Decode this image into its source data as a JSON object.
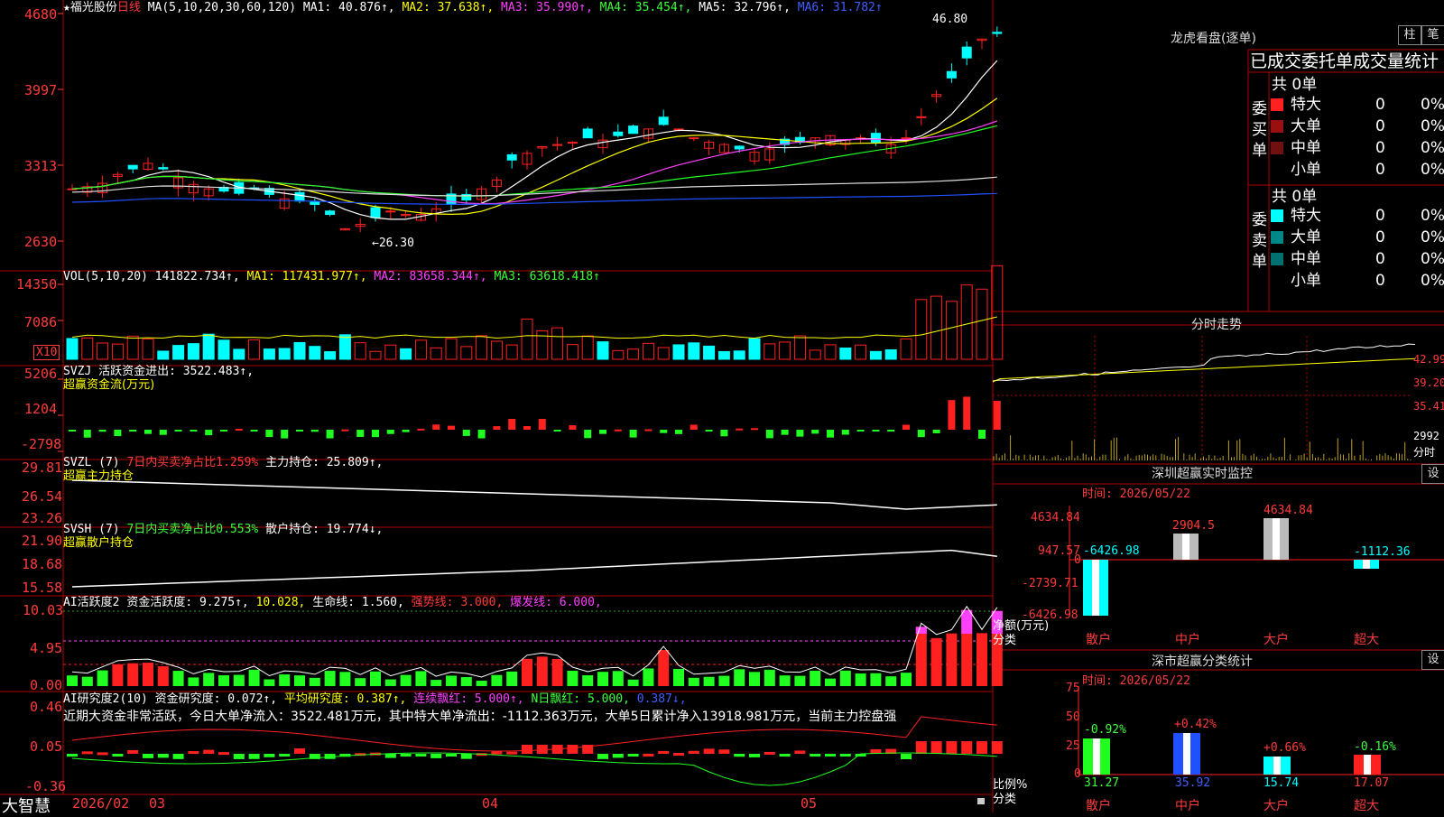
{
  "colors": {
    "up": "#ff2020",
    "down": "#00ffff",
    "bg": "#000000",
    "border": "#b00000",
    "white": "#ffffff",
    "yellow": "#ffff00",
    "magenta": "#ff40ff",
    "green": "#20ff20",
    "blue": "#2050ff"
  },
  "main": {
    "header_star": "★",
    "stock_name": "福光股份",
    "period": "日线",
    "ma_params": "MA(5,10,20,30,60,120)",
    "ma1": "MA1: 40.876↑,",
    "ma2": "MA2: 37.638↑,",
    "ma3": "MA3: 35.990↑,",
    "ma4": "MA4: 35.454↑,",
    "ma5": "MA5: 32.796↑,",
    "ma6": "MA6: 31.782↑",
    "price_ticks": [
      "4680",
      "3997",
      "3313",
      "2630"
    ],
    "high_label": "46.80",
    "low_label": "←26.30"
  },
  "vol": {
    "title": "VOL(5,10,20)",
    "val": "141822.734↑,",
    "ma1": "MA1: 117431.977↑,",
    "ma2": "MA2: 83658.344↑,",
    "ma3": "MA3: 63618.418↑",
    "ticks": [
      "14350",
      "7086"
    ],
    "unit": "X10"
  },
  "svzj": {
    "title": "SVZJ",
    "label": "活跃资金进出: 3522.483↑,",
    "subtitle": "超赢资金流(万元)",
    "ticks": [
      "5206",
      "1204",
      "-2798"
    ]
  },
  "svzl": {
    "title": "SVZL (7)",
    "ratio": "7日内买卖净占比1.259%",
    "label": "主力持仓: 25.809↑,",
    "subtitle": "超赢主力持仓",
    "ticks": [
      "29.81",
      "26.54",
      "23.26"
    ]
  },
  "svsh": {
    "title": "SVSH (7)",
    "ratio": "7日内买卖净占比0.553%",
    "label": "散户持仓: 19.774↓,",
    "subtitle": "超赢散户持仓",
    "ticks": [
      "21.90",
      "18.68",
      "15.58"
    ]
  },
  "ai1": {
    "title": "AI活跃度2",
    "a": "资金活跃度: 9.275↑,",
    "b": "10.028,",
    "c": "生命线: 1.560,",
    "d": "强势线: 3.000,",
    "e": "爆发线: 6.000,",
    "ticks": [
      "10.03",
      "4.95",
      "0.00"
    ]
  },
  "ai2": {
    "title": "AI研究度2(10)",
    "a": "资金研究度: 0.072↑,",
    "b": "平均研究度: 0.387↑,",
    "c": "连续飘红: 5.000↑,",
    "d": "N日飘红: 5.000,",
    "e": "0.387↓,",
    "comment": "近期大资金非常活跃，今日大单净流入：3522.481万元，其中特大单净流出：-1112.363万元，大单5日累计净入13918.981万元，当前主力控盘强",
    "ticks": [
      "0.46",
      "0.05",
      "-0.36"
    ]
  },
  "footer": {
    "brand": "大智慧",
    "dates": [
      "2026/02",
      "03",
      "04",
      "05"
    ]
  },
  "dragon": {
    "title": "龙虎看盘(逐单)",
    "btn1": "柱",
    "btn2": "笔",
    "subtitle": "已成交委托单成交量统计",
    "buy_label": "委买单",
    "sell_label": "委卖单",
    "buy_total": "共 0单",
    "sell_total": "共 0单",
    "buy_rows": [
      {
        "label": "特大",
        "count": "0",
        "pct": "0%"
      },
      {
        "label": "大单",
        "count": "0",
        "pct": "0%"
      },
      {
        "label": "中单",
        "count": "0",
        "pct": "0%"
      },
      {
        "label": "小单",
        "count": "0",
        "pct": "0%"
      }
    ],
    "sell_rows": [
      {
        "label": "特大",
        "count": "0",
        "pct": "0%"
      },
      {
        "label": "大单",
        "count": "0",
        "pct": "0%"
      },
      {
        "label": "中单",
        "count": "0",
        "pct": "0%"
      },
      {
        "label": "小单",
        "count": "0",
        "pct": "0%"
      }
    ]
  },
  "intraday": {
    "title": "分时走势",
    "ticks": [
      "42.99",
      "39.20",
      "35.41"
    ],
    "vol_tick": "2992",
    "unit": "分时"
  },
  "sz_monitor": {
    "title": "深圳超赢实时监控",
    "settings": "设",
    "time": "时间: 2026/05/22",
    "ticks": [
      "4634.84",
      "947.57",
      "0",
      "-2739.71",
      "-6426.98"
    ],
    "bar_labels": [
      "-6426.98",
      "2904.5",
      "4634.84",
      "-1112.36"
    ],
    "categories": [
      "散户",
      "中户",
      "大户",
      "超大"
    ],
    "axis_label_1": "净额(万元)",
    "axis_label_2": "分类"
  },
  "sz_class": {
    "title": "深市超赢分类统计",
    "settings": "设",
    "time": "时间: 2026/05/22",
    "ticks": [
      "75",
      "50",
      "25",
      "0"
    ],
    "changes": [
      "-0.92%",
      "+0.42%",
      "+0.66%",
      "-0.16%"
    ],
    "values": [
      "31.27",
      "35.92",
      "15.74",
      "17.07"
    ],
    "categories": [
      "散户",
      "中户",
      "大户",
      "超大"
    ],
    "axis_label_1": "比例%",
    "axis_label_2": "分类"
  }
}
